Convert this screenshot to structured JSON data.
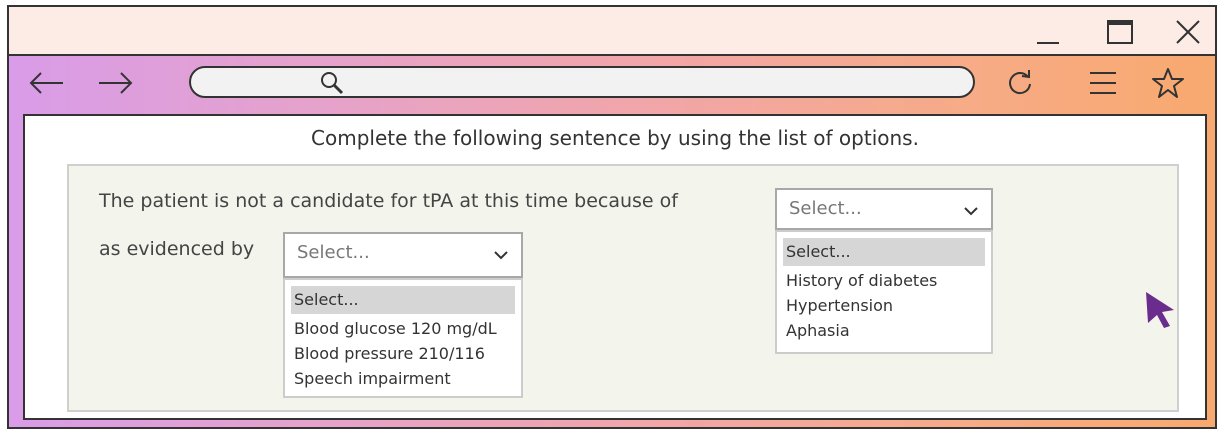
{
  "heading": "Complete the following sentence by using the  list of options.",
  "sentence": {
    "part1": "The patient is not a candidate for tPA at this time because of",
    "part2": "as evidenced by"
  },
  "select1": {
    "value": "Select...",
    "options": [
      "Select...",
      "History of diabetes",
      "Hypertension",
      "Aphasia"
    ]
  },
  "select2": {
    "value": "Select...",
    "options": [
      "Select...",
      "Blood glucose 120 mg/dL",
      "Blood pressure 210/116",
      "Speech impairment"
    ]
  },
  "icons": {
    "minimize": "minimize-icon",
    "maximize": "maximize-icon",
    "close": "close-icon",
    "back": "back-arrow-icon",
    "forward": "forward-arrow-icon",
    "search": "search-icon",
    "reload": "reload-icon",
    "menu": "menu-icon",
    "bookmark": "star-icon",
    "cursor": "mouse-cursor-icon"
  },
  "colors": {
    "gradient_start": "#d99ce8",
    "gradient_end": "#f8a96f",
    "titlebar": "#fdece6",
    "panel": "#f3f4ec",
    "cursor": "#6a2d8e"
  }
}
